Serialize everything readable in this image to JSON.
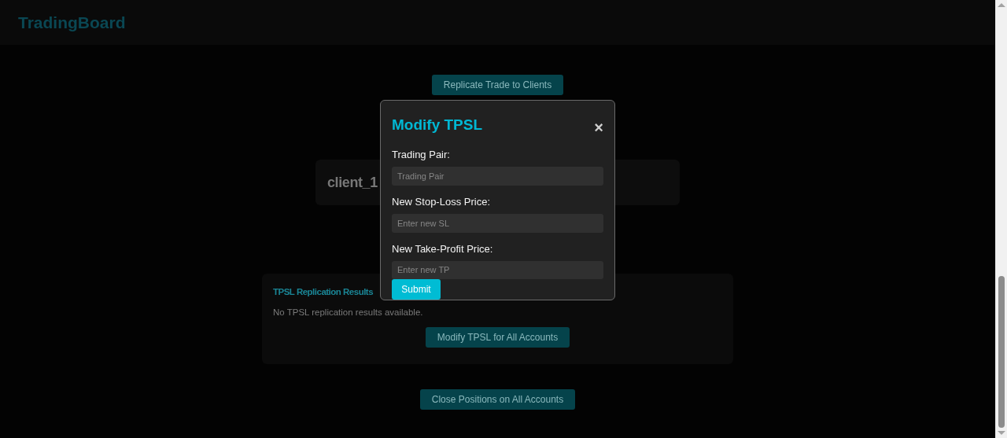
{
  "header": {
    "title": "TradingBoard"
  },
  "replicate_button": {
    "label": "Replicate Trade to Clients"
  },
  "client_card": {
    "name": "client_1"
  },
  "results_card": {
    "title": "TPSL Replication Results",
    "message": "No TPSL replication results available.",
    "button": "Modify TPSL for All Accounts"
  },
  "close_positions_button": {
    "label": "Close Positions on All Accounts"
  },
  "modal": {
    "title": "Modify TPSL",
    "close": "×",
    "fields": [
      {
        "label": "Trading Pair:",
        "placeholder": "Trading Pair"
      },
      {
        "label": "New Stop-Loss Price:",
        "placeholder": "Enter new SL"
      },
      {
        "label": "New Take-Profit Price:",
        "placeholder": "Enter new TP"
      }
    ],
    "submit": "Submit"
  }
}
